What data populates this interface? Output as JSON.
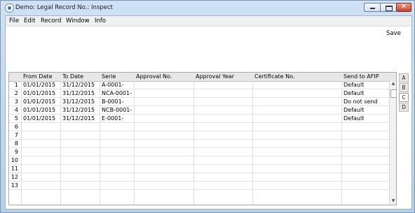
{
  "window": {
    "title": "Demo: Legal Record No.: Inspect",
    "controls": {
      "minimize": "minimize",
      "maximize": "maximize",
      "close": "✕"
    }
  },
  "menubar": {
    "items": [
      "File",
      "Edit",
      "Record",
      "Window",
      "Info"
    ]
  },
  "toolbar": {
    "save_label": "Save"
  },
  "grid": {
    "columns": [
      "From Date",
      "To Date",
      "Serie",
      "Approval No.",
      "Approval Year",
      "Certificate No.",
      "Send to AFIP"
    ],
    "rows": [
      {
        "num": "1",
        "from": "01/01/2015",
        "to": "31/12/2015",
        "serie": "A-0001-",
        "send": "Default"
      },
      {
        "num": "2",
        "from": "01/01/2015",
        "to": "31/12/2015",
        "serie": "NCA-0001-",
        "send": "Default"
      },
      {
        "num": "3",
        "from": "01/01/2015",
        "to": "31/12/2015",
        "serie": "B-0001-",
        "send": "Do not send"
      },
      {
        "num": "4",
        "from": "01/01/2015",
        "to": "31/12/2015",
        "serie": "NCB-0001-",
        "send": "Default"
      },
      {
        "num": "5",
        "from": "01/01/2015",
        "to": "31/12/2015",
        "serie": "E-0001-",
        "send": "Default"
      },
      {
        "num": "6"
      },
      {
        "num": "7"
      },
      {
        "num": "8"
      },
      {
        "num": "9"
      },
      {
        "num": "10"
      },
      {
        "num": "11"
      },
      {
        "num": "12"
      },
      {
        "num": "13"
      }
    ]
  },
  "tabs": [
    "A",
    "B",
    "C",
    "D"
  ],
  "active_tab": "C",
  "scroll": {
    "up_icon": "▲",
    "down_icon": "▼"
  }
}
